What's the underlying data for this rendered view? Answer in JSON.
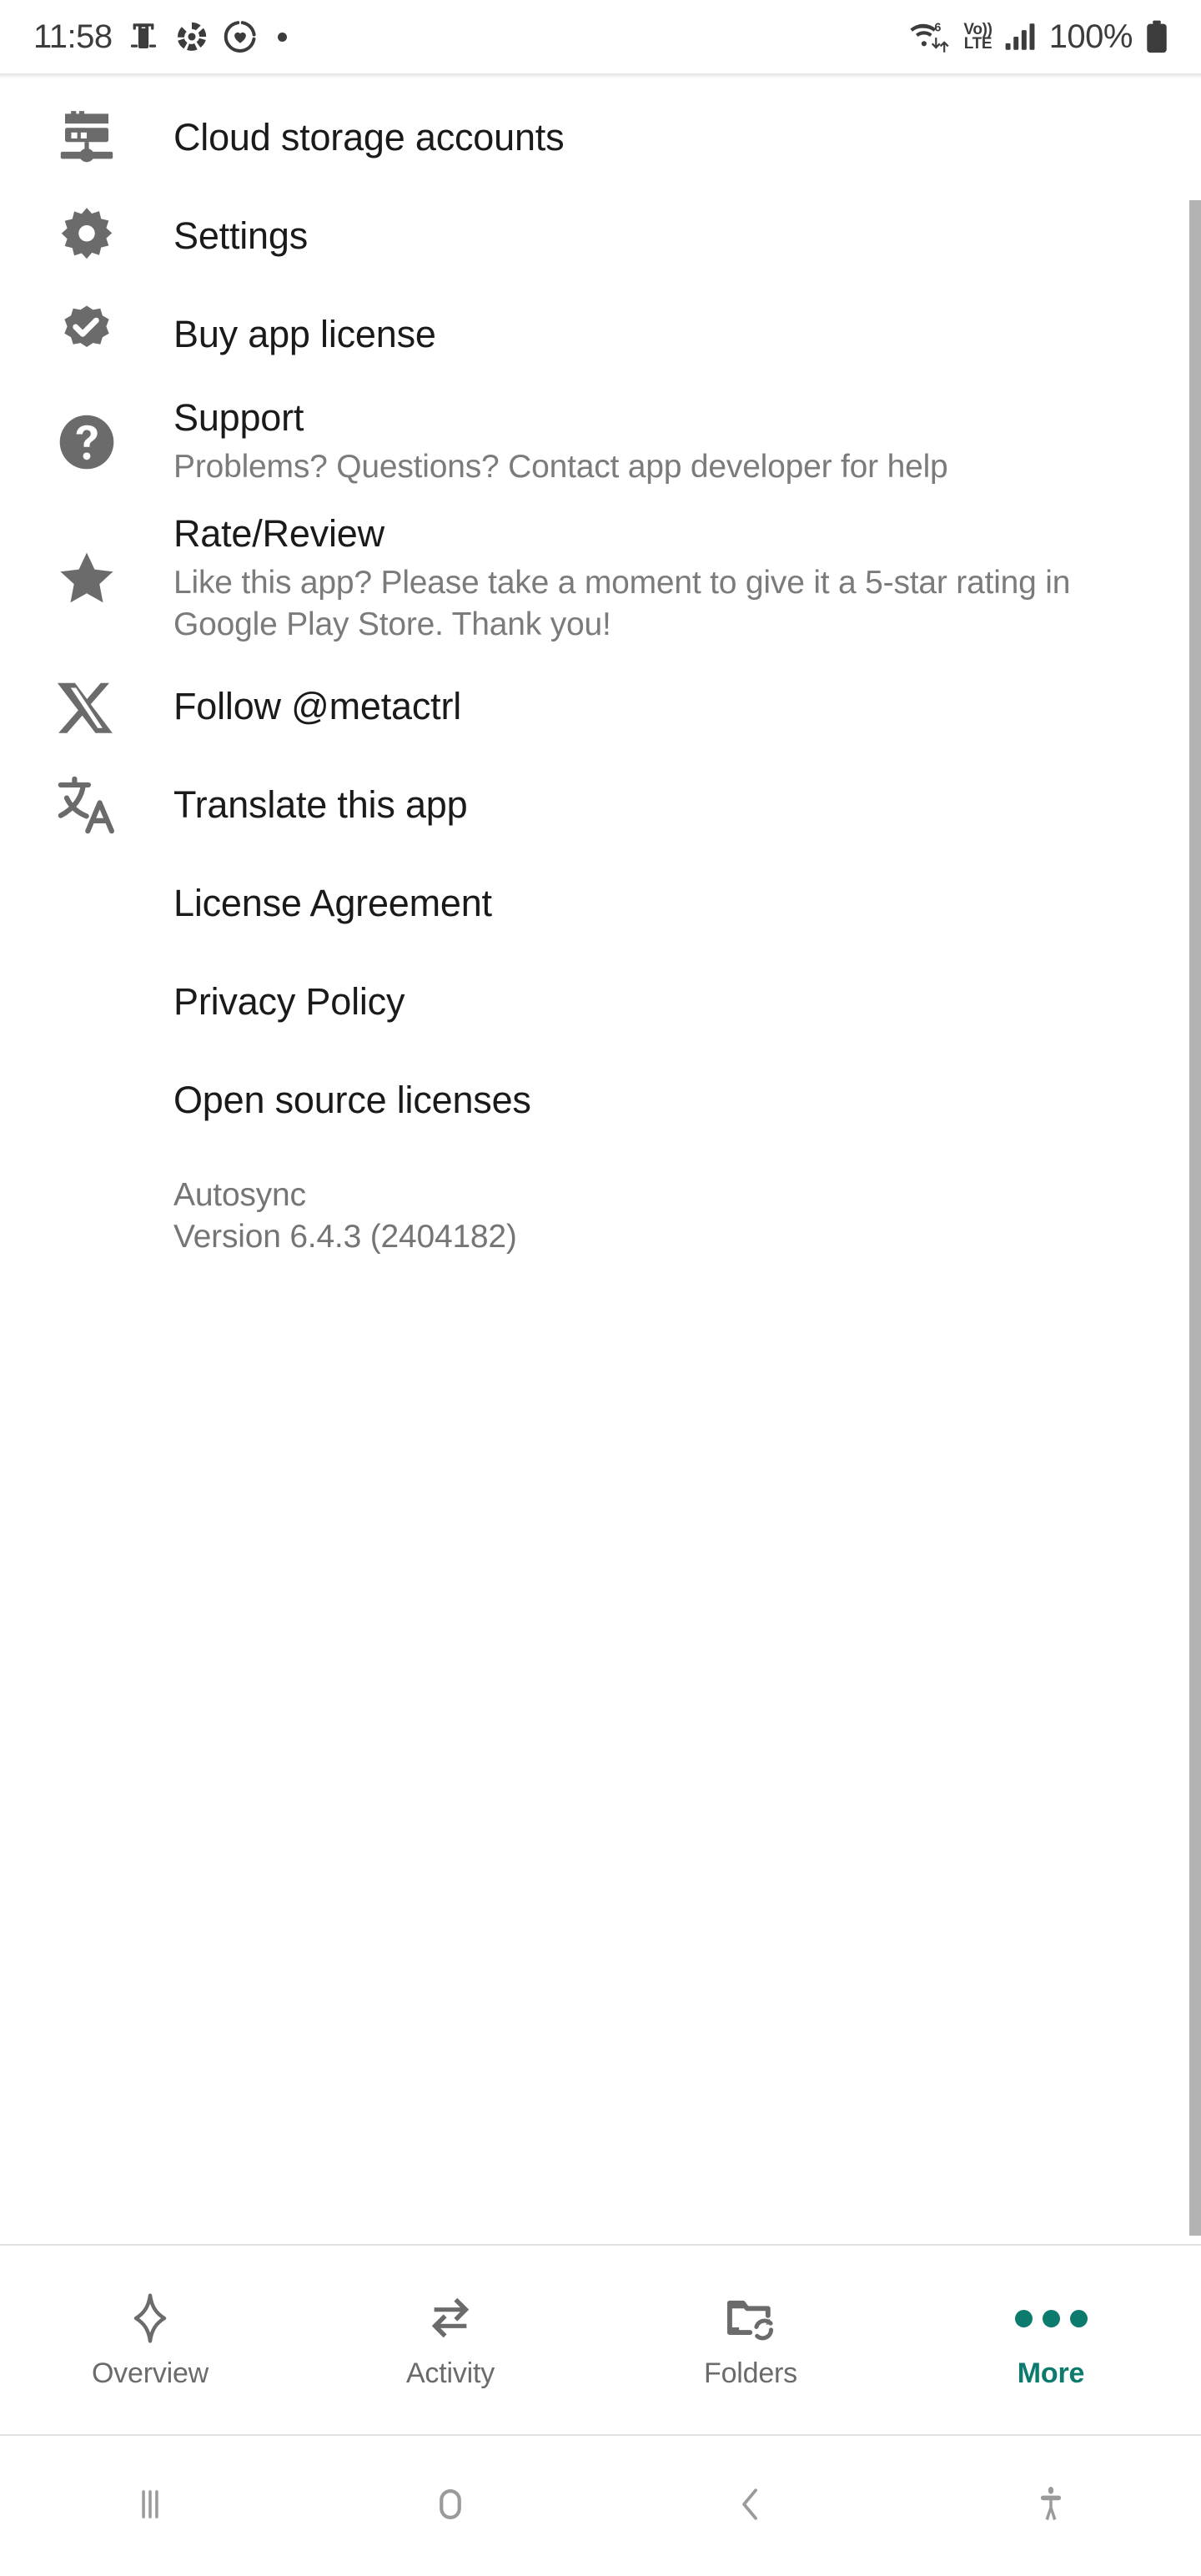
{
  "status_bar": {
    "time": "11:58",
    "icons_left": [
      "device-notification-icon",
      "sync-circle-icon",
      "heart-circle-icon",
      "notification-dot-icon"
    ],
    "wifi": "wifi-6-icon",
    "wifi_generation": "6",
    "volte_top": "Vo))",
    "volte_bottom": "LTE",
    "signal": "cellular-signal-icon",
    "battery_percent": "100%",
    "battery": "battery-full-icon"
  },
  "menu": {
    "items": [
      {
        "icon": "server-storage-icon",
        "title": "Cloud storage accounts",
        "subtitle": ""
      },
      {
        "icon": "gear-icon",
        "title": "Settings",
        "subtitle": ""
      },
      {
        "icon": "verified-badge-icon",
        "title": "Buy app license",
        "subtitle": ""
      },
      {
        "icon": "question-circle-icon",
        "title": "Support",
        "subtitle": "Problems? Questions? Contact app developer for help"
      },
      {
        "icon": "star-icon",
        "title": "Rate/Review",
        "subtitle": "Like this app? Please take a moment to give it a 5-star rating in Google Play Store. Thank you!"
      },
      {
        "icon": "x-twitter-icon",
        "title": "Follow @metactrl",
        "subtitle": ""
      },
      {
        "icon": "translate-icon",
        "title": "Translate this app",
        "subtitle": ""
      },
      {
        "icon": "",
        "title": "License Agreement",
        "subtitle": ""
      },
      {
        "icon": "",
        "title": "Privacy Policy",
        "subtitle": ""
      },
      {
        "icon": "",
        "title": "Open source licenses",
        "subtitle": ""
      }
    ],
    "app_name": "Autosync",
    "app_version": "Version 6.4.3 (2404182)"
  },
  "bottom_nav": {
    "active_color": "#0c7a6c",
    "inactive_color": "#6b6b6b",
    "items": [
      {
        "label": "Overview",
        "icon": "sparkle-star-icon",
        "active": false
      },
      {
        "label": "Activity",
        "icon": "two-way-arrows-icon",
        "active": false
      },
      {
        "label": "Folders",
        "icon": "folder-sync-icon",
        "active": false
      },
      {
        "label": "More",
        "icon": "three-dots-icon",
        "active": true
      }
    ]
  },
  "android_nav": {
    "items": [
      {
        "name": "recents-button",
        "icon": "three-bars-icon"
      },
      {
        "name": "home-button",
        "icon": "rounded-square-icon"
      },
      {
        "name": "back-button",
        "icon": "chevron-left-icon"
      },
      {
        "name": "accessibility-button",
        "icon": "accessibility-person-icon"
      }
    ]
  }
}
